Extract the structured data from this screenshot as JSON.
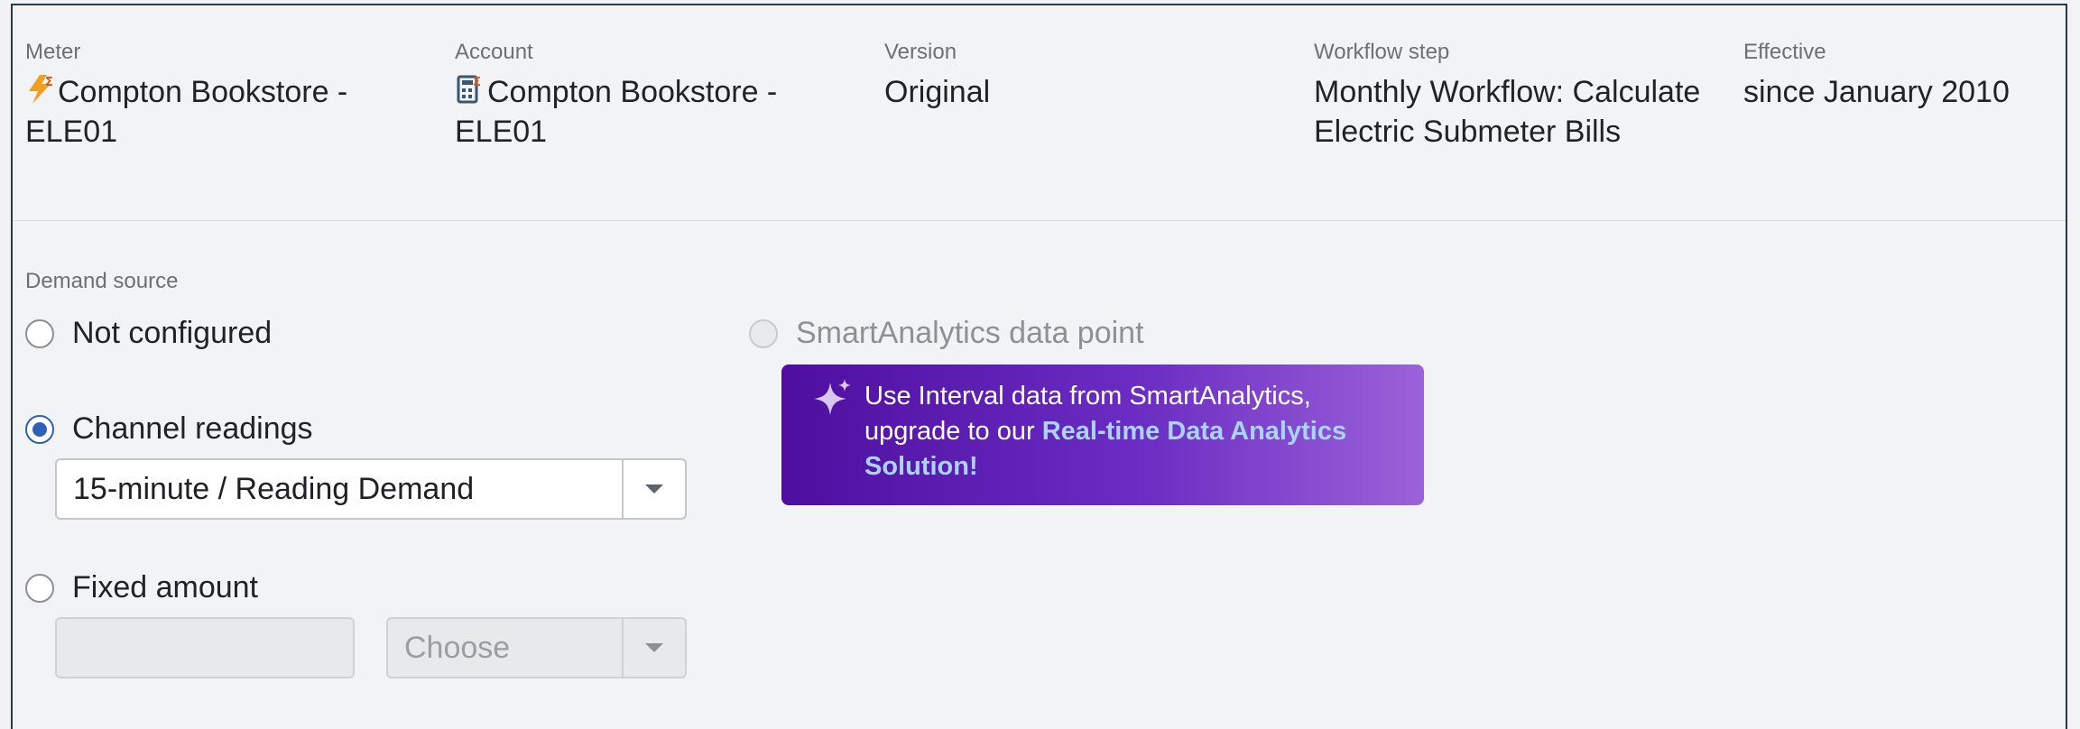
{
  "header": {
    "meter": {
      "label": "Meter",
      "value": "Compton Bookstore - ELE01",
      "icon": "meter-bolt-icon"
    },
    "account": {
      "label": "Account",
      "value": "Compton Bookstore - ELE01",
      "icon": "account-calculator-icon"
    },
    "version": {
      "label": "Version",
      "value": "Original"
    },
    "workflow": {
      "label": "Workflow step",
      "value": "Monthly Workflow: Calculate Electric Submeter Bills"
    },
    "effective": {
      "label": "Effective",
      "value": "since January 2010"
    }
  },
  "demand": {
    "section_label": "Demand source",
    "not_configured": "Not configured",
    "channel_readings": "Channel readings",
    "channel_select_value": "15-minute / Reading Demand",
    "fixed_amount": "Fixed amount",
    "fixed_unit_placeholder": "Choose",
    "smartanalytics": "SmartAnalytics data point",
    "selected": "channel_readings"
  },
  "promo": {
    "text": "Use Interval data from SmartAnalytics, upgrade to our ",
    "link": "Real-time Data Analytics Solution!",
    "icon": "sparkle-icon"
  },
  "colors": {
    "accent": "#2f5fb8",
    "promo_start": "#4e0fa0",
    "promo_end": "#9b62d9",
    "promo_link": "#a8d4ff"
  }
}
